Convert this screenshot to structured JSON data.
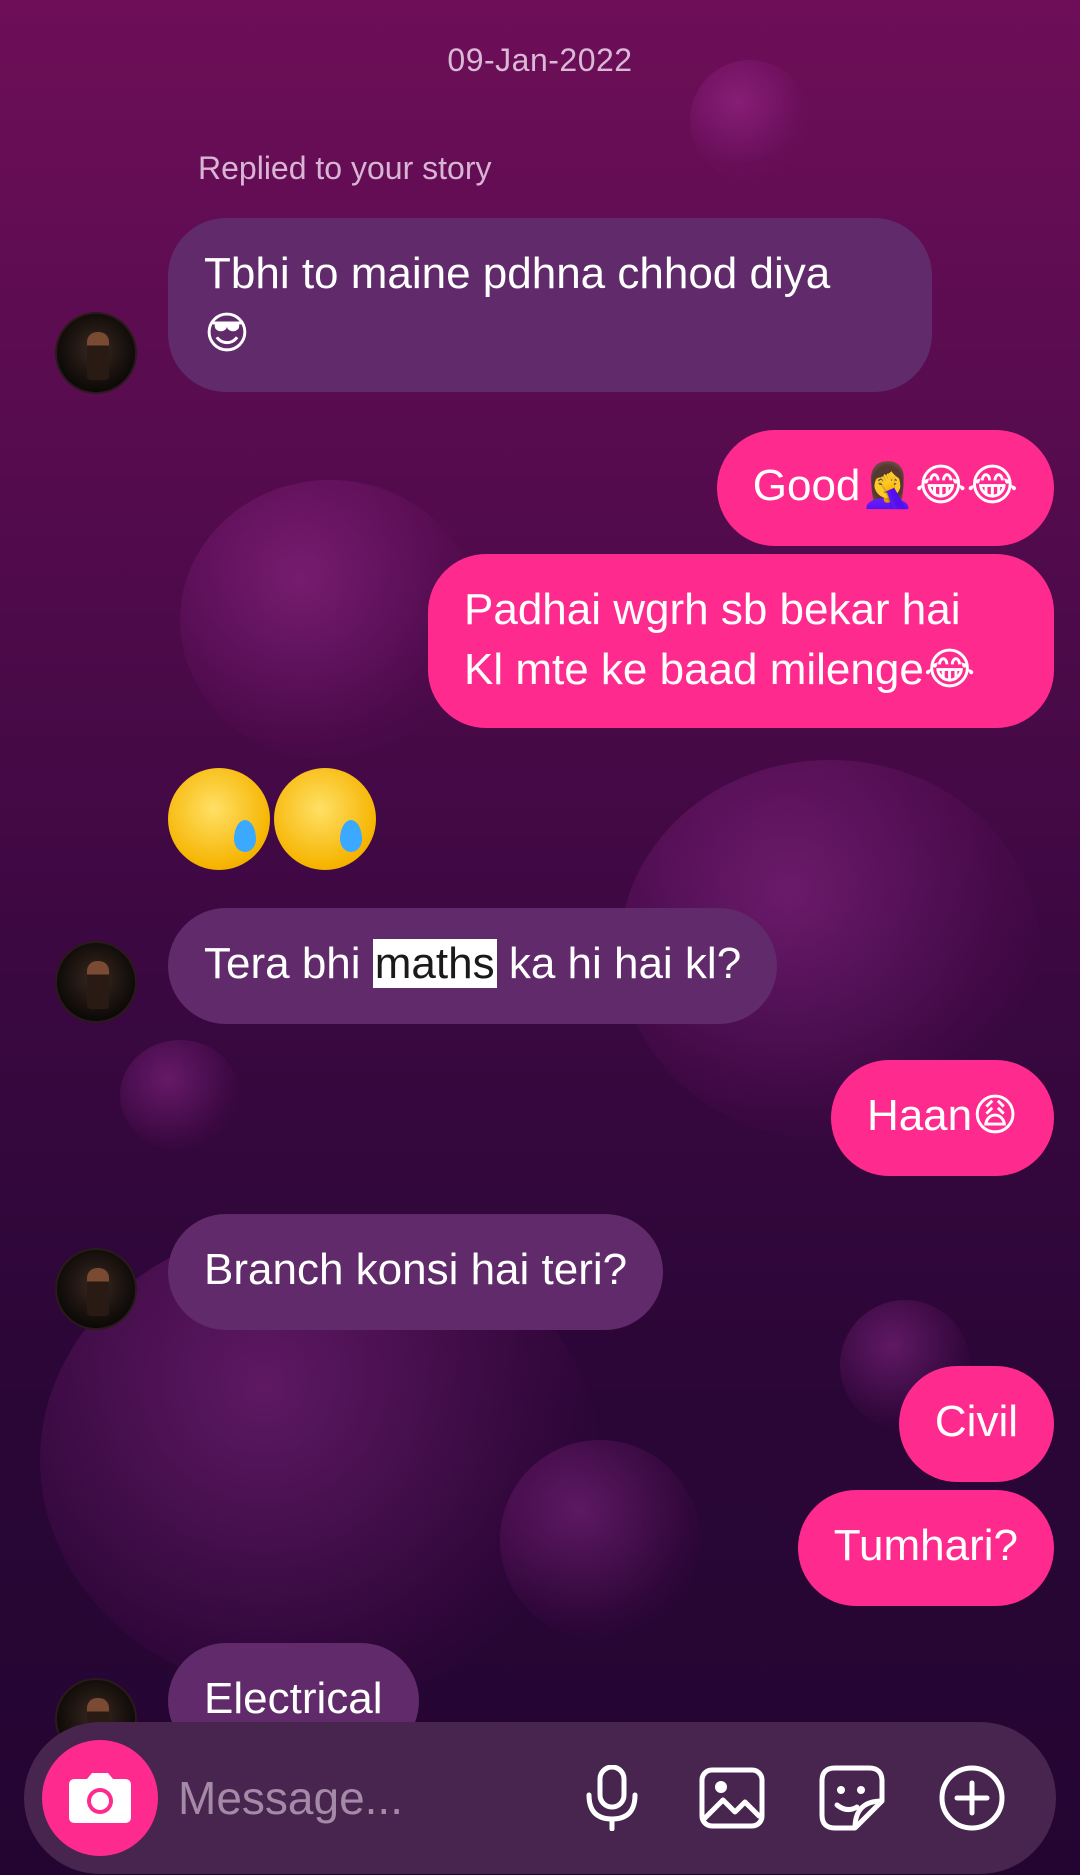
{
  "date": "09-Jan-2022",
  "reply_note": "Replied to your story",
  "messages": {
    "m1": {
      "line1": "Tbhi to maine pdhna chhod diya",
      "emoji": "😎"
    },
    "m2": {
      "text": "Good",
      "emoji": "🤦‍♀️😂😂"
    },
    "m3": {
      "line1": "Padhai wgrh sb bekar hai",
      "line2": "Kl mte ke baad milenge",
      "emoji": "😂"
    },
    "m4": {
      "emoji": "🥲🥲"
    },
    "m5": {
      "pre": "Tera bhi ",
      "highlight": "maths",
      "post": " ka hi hai kl?"
    },
    "m6": {
      "text": "Haan",
      "emoji": "😩"
    },
    "m7": {
      "text": "Branch konsi hai teri?"
    },
    "m8": {
      "text": "Civil"
    },
    "m9": {
      "text": "Tumhari?"
    },
    "m10": {
      "text": "Electrical"
    }
  },
  "composer": {
    "placeholder": "Message...",
    "icons": [
      "camera-icon",
      "microphone-icon",
      "gallery-icon",
      "sticker-icon",
      "plus-icon"
    ]
  },
  "colors": {
    "outgoing_bubble": "#ff2a8e",
    "incoming_bubble": "#612a6a",
    "composer_bg": "#47254f"
  }
}
